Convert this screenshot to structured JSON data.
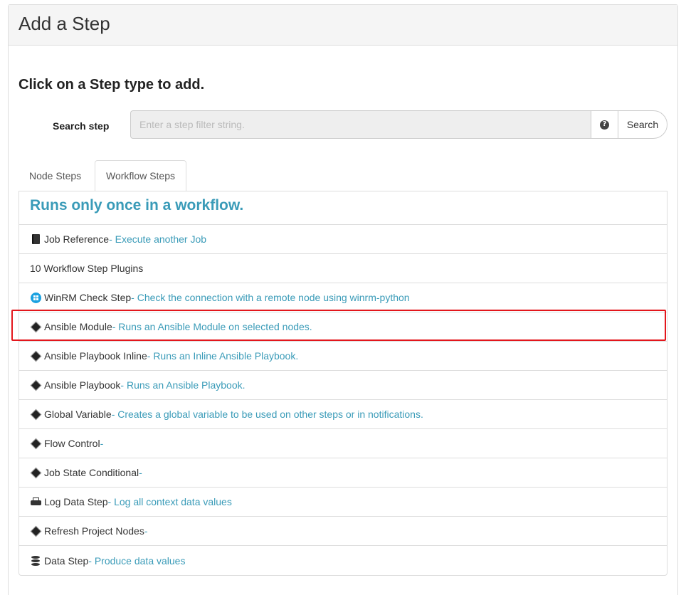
{
  "panel": {
    "title": "Add a Step"
  },
  "prompt": "Click on a Step type to add.",
  "search": {
    "label": "Search step",
    "placeholder": "Enter a step filter string.",
    "value": "",
    "help_icon": "question-circle-icon",
    "button_label": "Search"
  },
  "tabs": [
    {
      "label": "Node Steps",
      "active": false
    },
    {
      "label": "Workflow Steps",
      "active": true
    }
  ],
  "list": {
    "header": "Runs only once in a workflow.",
    "items": [
      {
        "icon": "book-icon",
        "name": "Job Reference",
        "desc": " - Execute another Job"
      },
      {
        "icon": "",
        "name": "10 Workflow Step Plugins",
        "desc": ""
      },
      {
        "icon": "windows-icon",
        "name": "WinRM Check Step",
        "desc": " - Check the connection with a remote node using winrm-python"
      },
      {
        "icon": "diamond-icon",
        "name": "Ansible Module",
        "desc": " - Runs an Ansible Module on selected nodes."
      },
      {
        "icon": "diamond-icon",
        "name": "Ansible Playbook Inline",
        "desc": " - Runs an Inline Ansible Playbook."
      },
      {
        "icon": "diamond-icon",
        "name": "Ansible Playbook",
        "desc": " - Runs an Ansible Playbook."
      },
      {
        "icon": "diamond-icon",
        "name": "Global Variable",
        "desc": " - Creates a global variable to be used on other steps or in notifications."
      },
      {
        "icon": "diamond-icon",
        "name": "Flow Control",
        "desc": " -"
      },
      {
        "icon": "diamond-icon",
        "name": "Job State Conditional",
        "desc": " -"
      },
      {
        "icon": "print-icon",
        "name": "Log Data Step",
        "desc": " - Log all context data values"
      },
      {
        "icon": "diamond-icon",
        "name": "Refresh Project Nodes",
        "desc": " -"
      },
      {
        "icon": "database-icon",
        "name": "Data Step",
        "desc": " - Produce data values"
      }
    ]
  },
  "colors": {
    "accent": "#3a9bb8",
    "highlight": "#e3161c"
  }
}
